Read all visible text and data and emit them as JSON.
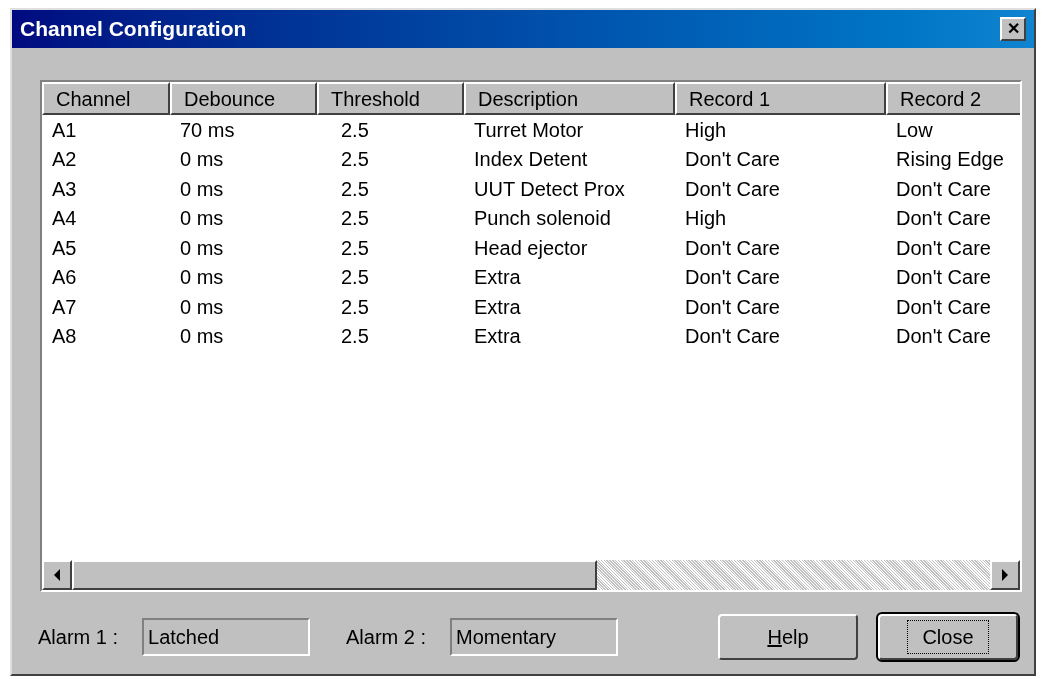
{
  "window": {
    "title": "Channel Configuration",
    "close_glyph": "✕"
  },
  "table": {
    "columns": [
      "Channel",
      "Debounce",
      "Threshold",
      "Description",
      "Record 1",
      "Record 2"
    ],
    "rows": [
      [
        "A1",
        "70 ms",
        "2.5",
        "Turret Motor",
        "High",
        "Low"
      ],
      [
        "A2",
        "0 ms",
        "2.5",
        "Index Detent",
        "Don't Care",
        "Rising Edge"
      ],
      [
        "A3",
        "0 ms",
        "2.5",
        "UUT Detect Prox",
        "Don't Care",
        "Don't Care"
      ],
      [
        "A4",
        "0 ms",
        "2.5",
        "Punch solenoid",
        "High",
        "Don't Care"
      ],
      [
        "A5",
        "0 ms",
        "2.5",
        "Head ejector",
        "Don't Care",
        "Don't Care"
      ],
      [
        "A6",
        "0 ms",
        "2.5",
        "Extra",
        "Don't Care",
        "Don't Care"
      ],
      [
        "A7",
        "0 ms",
        "2.5",
        "Extra",
        "Don't Care",
        "Don't Care"
      ],
      [
        "A8",
        "0 ms",
        "2.5",
        "Extra",
        "Don't Care",
        "Don't Care"
      ]
    ]
  },
  "alarms": [
    {
      "label": "Alarm 1 :",
      "value": "Latched"
    },
    {
      "label": "Alarm 2 :",
      "value": "Momentary"
    }
  ],
  "buttons": [
    {
      "label": "Help",
      "underline_first": true,
      "focused": false
    },
    {
      "label": "Close",
      "underline_first": false,
      "focused": true
    }
  ]
}
